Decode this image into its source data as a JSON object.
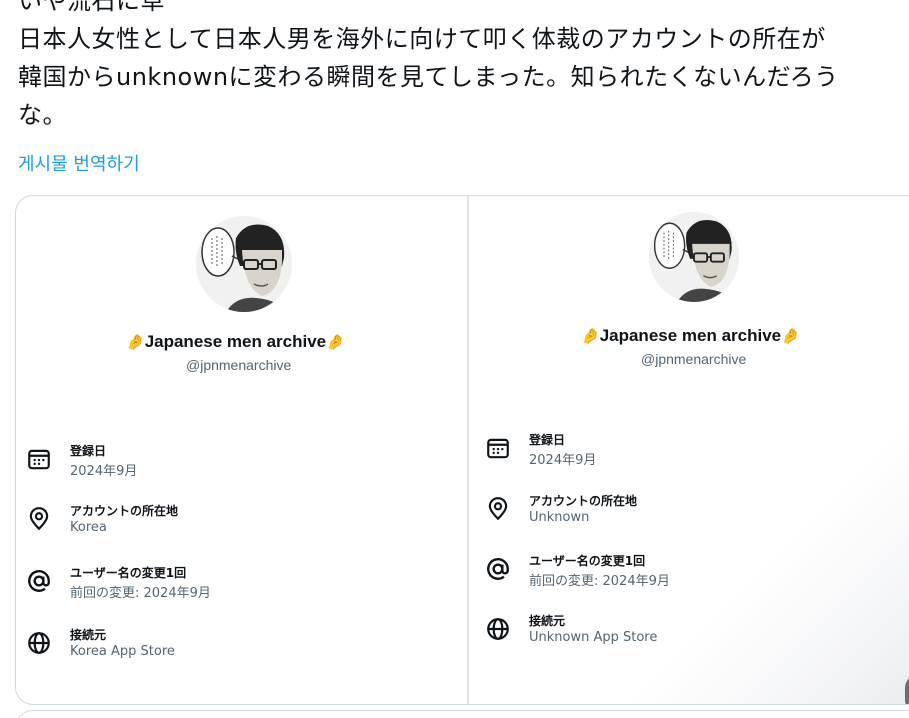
{
  "tweet": {
    "lines": [
      "いや流石に草",
      "日本人女性として日本人男を海外に向けて叩く体裁のアカウントの所在が",
      "韓国からunknownに変わる瞬間を見てしまった。知られたくないんだろう",
      "な。"
    ],
    "translate_link": "게시물 번역하기"
  },
  "card": {
    "display_name": "Japanese men archive",
    "handle": "@jpnmenarchive",
    "emoji_icon": "pinched-fingers-icon",
    "left": {
      "rows": [
        {
          "icon": "calendar-icon",
          "label": "登録日",
          "value": "2024年9月"
        },
        {
          "icon": "location-pin-icon",
          "label": "アカウントの所在地",
          "value": "Korea"
        },
        {
          "icon": "at-sign-icon",
          "label": "ユーザー名の変更1回",
          "value": "前回の変更: 2024年9月"
        },
        {
          "icon": "globe-icon",
          "label": "接続元",
          "value": "Korea App Store"
        }
      ]
    },
    "right": {
      "rows": [
        {
          "icon": "calendar-icon",
          "label": "登録日",
          "value": "2024年9月"
        },
        {
          "icon": "location-pin-icon",
          "label": "アカウントの所在地",
          "value": "Unknown"
        },
        {
          "icon": "at-sign-icon",
          "label": "ユーザー名の変更1回",
          "value": "前回の変更: 2024年9月"
        },
        {
          "icon": "globe-icon",
          "label": "接続元",
          "value": "Unknown App Store"
        }
      ]
    }
  },
  "colors": {
    "link": "#1d9bf0",
    "text": "#0f1419",
    "secondary": "#536471",
    "border": "#cfd9de"
  }
}
